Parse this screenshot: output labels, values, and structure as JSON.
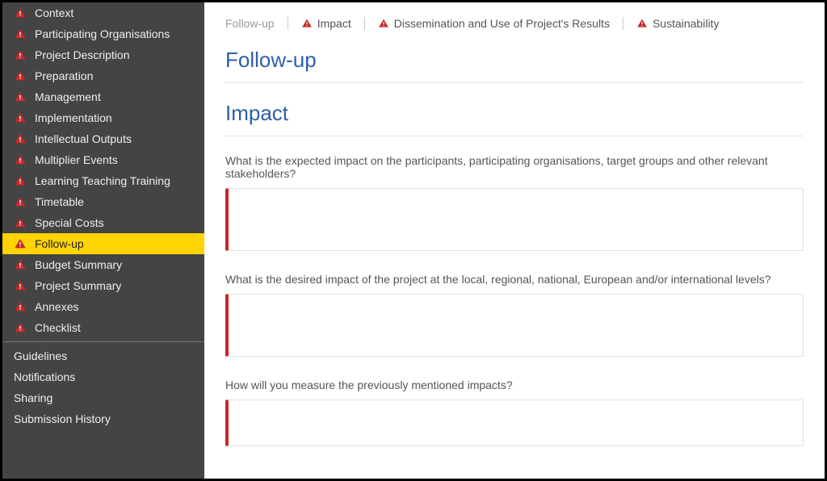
{
  "sidebar": {
    "items": [
      {
        "label": "Context",
        "active": false
      },
      {
        "label": "Participating Organisations",
        "active": false
      },
      {
        "label": "Project Description",
        "active": false
      },
      {
        "label": "Preparation",
        "active": false
      },
      {
        "label": "Management",
        "active": false
      },
      {
        "label": "Implementation",
        "active": false
      },
      {
        "label": "Intellectual Outputs",
        "active": false
      },
      {
        "label": "Multiplier Events",
        "active": false
      },
      {
        "label": "Learning Teaching Training",
        "active": false
      },
      {
        "label": "Timetable",
        "active": false
      },
      {
        "label": "Special Costs",
        "active": false
      },
      {
        "label": "Follow-up",
        "active": true
      },
      {
        "label": "Budget Summary",
        "active": false
      },
      {
        "label": "Project Summary",
        "active": false
      },
      {
        "label": "Annexes",
        "active": false
      },
      {
        "label": "Checklist",
        "active": false
      }
    ],
    "secondary": [
      {
        "label": "Guidelines"
      },
      {
        "label": "Notifications"
      },
      {
        "label": "Sharing"
      },
      {
        "label": "Submission History"
      }
    ]
  },
  "tabs": [
    {
      "label": "Follow-up",
      "active": true,
      "warning": false
    },
    {
      "label": "Impact",
      "active": false,
      "warning": true
    },
    {
      "label": "Dissemination and Use of Project's Results",
      "active": false,
      "warning": true
    },
    {
      "label": "Sustainability",
      "active": false,
      "warning": true
    }
  ],
  "main": {
    "heading_followup": "Follow-up",
    "heading_impact": "Impact",
    "q1": "What is the expected impact on the participants, participating organisations, target groups and other relevant stakeholders?",
    "q2": "What is the desired impact of the project at the local, regional, national, European and/or international levels?",
    "q3": "How will you measure the previously mentioned impacts?",
    "a1": "",
    "a2": "",
    "a3": ""
  },
  "colors": {
    "accent_blue": "#2e5faa",
    "warning_red": "#c62828",
    "highlight_yellow": "#ffd400",
    "sidebar_bg": "#444444"
  }
}
